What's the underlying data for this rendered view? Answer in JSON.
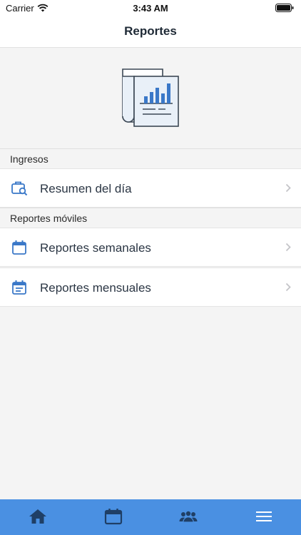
{
  "status_bar": {
    "carrier": "Carrier",
    "time": "3:43 AM"
  },
  "nav": {
    "title": "Reportes"
  },
  "sections": [
    {
      "header": "Ingresos",
      "items": [
        {
          "label": "Resumen del día",
          "icon": "briefcase-search-icon"
        }
      ]
    },
    {
      "header": "Reportes móviles",
      "items": [
        {
          "label": "Reportes semanales",
          "icon": "calendar-icon"
        },
        {
          "label": "Reportes mensuales",
          "icon": "calendar-list-icon"
        }
      ]
    }
  ],
  "tab_bar": {
    "tabs": [
      {
        "icon": "home-icon"
      },
      {
        "icon": "calendar-icon"
      },
      {
        "icon": "users-icon"
      },
      {
        "icon": "menu-icon"
      }
    ]
  },
  "colors": {
    "accent": "#4a90e2",
    "icon_blue": "#3a78c8",
    "background": "#f4f4f4",
    "text": "#1f2a36"
  }
}
